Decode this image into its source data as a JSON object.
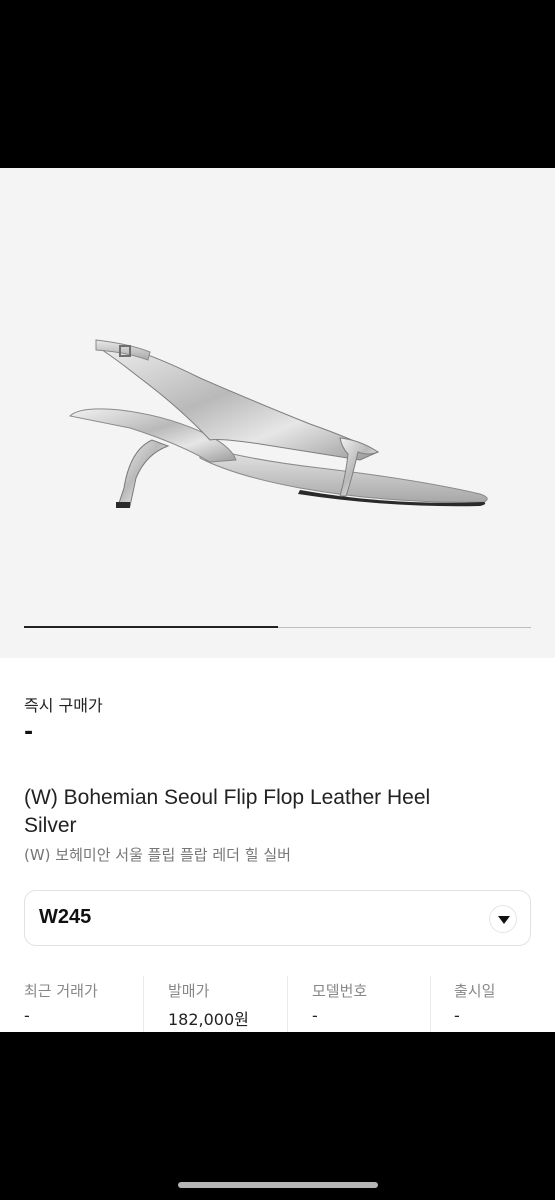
{
  "product": {
    "image_icon": "silver-slingback-sandal",
    "instant_buy_label": "즉시 구매가",
    "instant_buy_price": "-",
    "title": "(W) Bohemian Seoul Flip Flop Leather Heel Silver",
    "subtitle": "(W) 보헤미안 서울 플립 플랍 레더 힐 실버",
    "image_progress": 0.5
  },
  "size_select": {
    "value": "W245"
  },
  "info": [
    {
      "label": "최근 거래가",
      "value": "-"
    },
    {
      "label": "발매가",
      "value": "182,000원"
    },
    {
      "label": "모델번호",
      "value": "-"
    },
    {
      "label": "출시일",
      "value": "-"
    }
  ],
  "colors": {
    "image_background": "#f4f4f4",
    "accent": "#222222"
  }
}
